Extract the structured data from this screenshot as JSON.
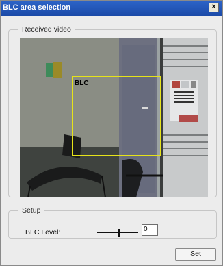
{
  "window": {
    "title": "BLC area selection"
  },
  "video_group": {
    "legend": "Received video",
    "overlay_label": "BLC",
    "overlay_color": "#e6e31a"
  },
  "setup_group": {
    "legend": "Setup",
    "blc_label": "BLC Level:",
    "blc_value": "0"
  },
  "buttons": {
    "set_label": "Set",
    "close_symbol": "×"
  },
  "icons": {
    "close": "close-icon"
  }
}
